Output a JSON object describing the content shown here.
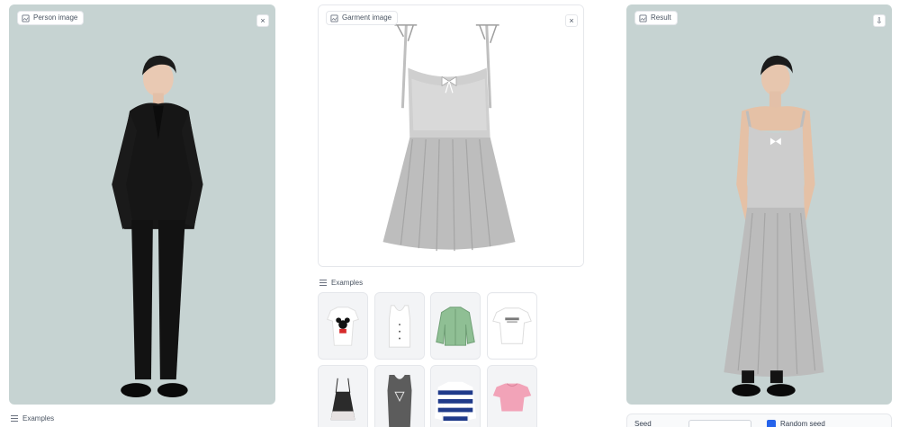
{
  "person_panel": {
    "label": "Person image",
    "close_glyph": "×",
    "icon": "image-icon"
  },
  "person_examples": {
    "label": "Examples"
  },
  "garment_panel": {
    "label": "Garment image",
    "close_glyph": "×",
    "icon": "image-icon"
  },
  "garment_examples": {
    "label": "Examples",
    "items": [
      "minnie-tshirt",
      "white-button-tank",
      "green-denim-jacket",
      "white-logo-tee",
      "black-slip-dress",
      "grey-logo-tank",
      "striped-rugby-shirt",
      "pink-crop-top"
    ]
  },
  "result_panel": {
    "label": "Result",
    "download_glyph": "⇩",
    "icon": "image-icon"
  },
  "result_footer": {
    "seed_label": "Seed",
    "randomize_label": "Random seed"
  },
  "colors": {
    "backdrop": "#c6d3d2",
    "accent": "#2563eb",
    "border": "#e5e7eb"
  }
}
